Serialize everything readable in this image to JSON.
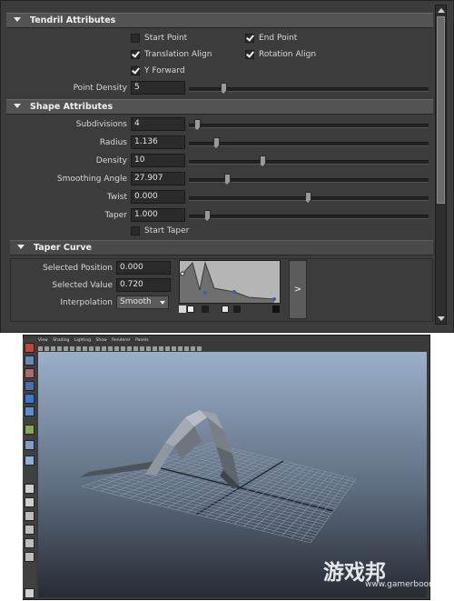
{
  "tendril": {
    "title": "Tendril Attributes",
    "checkboxes": [
      {
        "label": "Start Point",
        "checked": false
      },
      {
        "label": "End Point",
        "checked": true
      },
      {
        "label": "Translation Align",
        "checked": true
      },
      {
        "label": "Rotation Align",
        "checked": true
      },
      {
        "label": "Y Forward",
        "checked": true
      }
    ],
    "point_density": {
      "label": "Point Density",
      "value": "5"
    }
  },
  "shape": {
    "title": "Shape Attributes",
    "rows": [
      {
        "label": "Subdivisions",
        "value": "4"
      },
      {
        "label": "Radius",
        "value": "1.136"
      },
      {
        "label": "Density",
        "value": "10"
      },
      {
        "label": "Smoothing Angle",
        "value": "27.907"
      },
      {
        "label": "Twist",
        "value": "0.000"
      },
      {
        "label": "Taper",
        "value": "1.000"
      }
    ],
    "start_taper": {
      "label": "Start Taper",
      "checked": false
    }
  },
  "taper_curve": {
    "title": "Taper Curve",
    "selected_position": {
      "label": "Selected Position",
      "value": "0.000"
    },
    "selected_value": {
      "label": "Selected Value",
      "value": "0.720"
    },
    "interpolation": {
      "label": "Interpolation",
      "value": "Smooth"
    },
    "expand_label": ">"
  },
  "viewport": {
    "menu": [
      "View",
      "Shading",
      "Lighting",
      "Show",
      "Renderer",
      "Panels"
    ]
  },
  "watermark": {
    "text": "游戏邦",
    "url": "www.gamerboom.com"
  }
}
